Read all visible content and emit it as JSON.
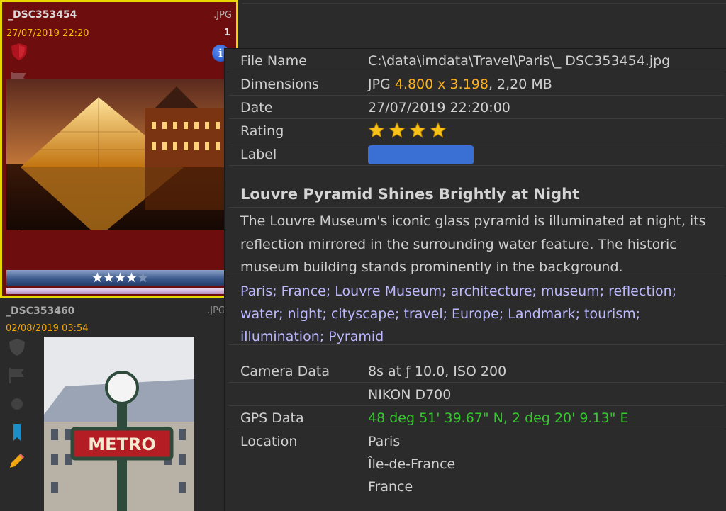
{
  "thumbnails": [
    {
      "name": "_DSC353454",
      "date": "27/07/2019 22:20",
      "ext": ".JPG",
      "number": "1",
      "rating_stars": 4,
      "rating_max": 5
    },
    {
      "name": "_DSC353460",
      "date": "02/08/2019 03:54",
      "ext": ".JPG"
    }
  ],
  "info": {
    "file_name": {
      "label": "File Name",
      "value": "C:\\data\\imdata\\Travel\\Paris\\_ DSC353454.jpg"
    },
    "dimensions": {
      "label": "Dimensions",
      "prefix": "JPG",
      "size": "4.800 x 3.198",
      "suffix": ", 2,20 MB"
    },
    "date": {
      "label": "Date",
      "value": "27/07/2019 22:20:00"
    },
    "rating": {
      "label": "Rating",
      "stars": 4
    },
    "label": {
      "label": "Label",
      "color": "#3a70d4"
    },
    "title": "Louvre Pyramid Shines Brightly at Night",
    "description": "The Louvre Museum's iconic glass pyramid is illuminated at night, its reflection mirrored in the surrounding water feature. The historic museum building stands prominently in the background.",
    "keywords": "Paris; France; Louvre Museum; architecture; museum; reflection; water; night; cityscape; travel; Europe; Landmark; tourism; illumination; Pyramid",
    "camera": {
      "label": "Camera Data",
      "exposure": "8s at ƒ 10.0, ISO 200",
      "model": "NIKON D700"
    },
    "gps": {
      "label": "GPS Data",
      "value": "48 deg 51' 39.67\" N, 2 deg 20' 9.13\" E"
    },
    "location": {
      "label": "Location",
      "city": "Paris",
      "region": "Île-de-France",
      "country": "France"
    }
  },
  "colors": {
    "accent_orange": "#ffb21a",
    "gps_green": "#35c82d",
    "keywords": "#bcb9ff",
    "selection_border": "#e6d800"
  },
  "photo2_sign": "METRO"
}
